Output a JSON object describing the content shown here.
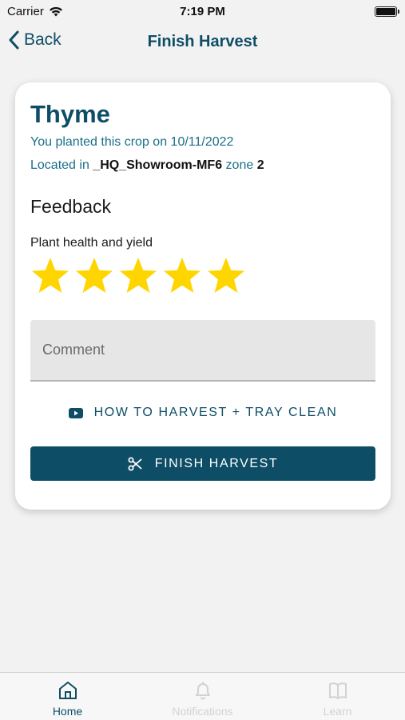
{
  "status_bar": {
    "carrier": "Carrier",
    "time": "7:19 PM"
  },
  "nav": {
    "back_label": "Back",
    "title": "Finish Harvest"
  },
  "crop": {
    "name": "Thyme",
    "planted_text": "You planted this crop on 10/11/2022",
    "located_prefix": "Located in",
    "location": "_HQ_Showroom-MF6",
    "zone_label": "zone",
    "zone": "2"
  },
  "feedback": {
    "heading": "Feedback",
    "rating_label": "Plant health and yield",
    "rating": 5,
    "rating_max": 5,
    "comment_placeholder": "Comment",
    "comment_value": ""
  },
  "actions": {
    "howto_label": "HOW TO HARVEST + TRAY CLEAN",
    "finish_label": "FINISH HARVEST"
  },
  "tabs": [
    {
      "label": "Home",
      "icon": "home-icon",
      "active": true
    },
    {
      "label": "Notifications",
      "icon": "bell-icon",
      "active": false
    },
    {
      "label": "Learn",
      "icon": "book-icon",
      "active": false
    }
  ],
  "colors": {
    "primary": "#0e4d66",
    "link": "#1b6f8a",
    "star": "#ffd500",
    "background": "#f2f2f2"
  }
}
